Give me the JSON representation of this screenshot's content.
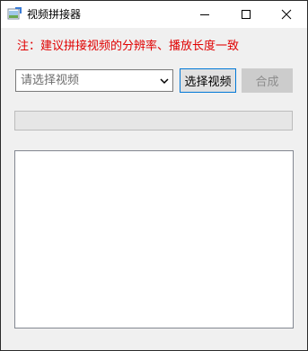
{
  "window": {
    "title": "视频拼接器"
  },
  "note": "注：建议拼接视频的分辨率、播放长度一致",
  "video_select": {
    "placeholder": "请选择视频"
  },
  "buttons": {
    "select_video": "选择视频",
    "merge": "合成"
  },
  "progress": {
    "value": 0
  },
  "log": {
    "text": ""
  },
  "colors": {
    "note": "#e00000",
    "accent": "#0078d7"
  }
}
